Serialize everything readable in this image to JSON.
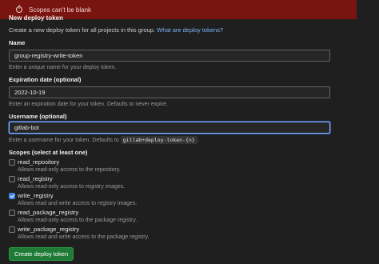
{
  "alert": {
    "message": "Scopes can't be blank",
    "icon": "error-circle-icon",
    "background": "#7a1410"
  },
  "form": {
    "title": "New deploy token",
    "description": "Create a new deploy token for all projects in this group.",
    "help_link": "What are deploy tokens?",
    "name": {
      "label": "Name",
      "value": "group-registry-write-token",
      "hint": "Enter a unique name for your deploy token."
    },
    "expiration": {
      "label": "Expiration date (optional)",
      "value": "2022-10-19",
      "hint": "Enter an expiration date for your token. Defaults to never expire."
    },
    "username": {
      "label": "Username (optional)",
      "value": "gitlab-bot",
      "hint_prefix": "Enter a username for your token. Defaults to",
      "hint_code": "gitlab+deploy-token-{n}",
      "hint_suffix": "."
    },
    "scopes_label": "Scopes (select at least one)",
    "scopes": [
      {
        "name": "read_repository",
        "description": "Allows read-only access to the repository.",
        "checked": false
      },
      {
        "name": "read_registry",
        "description": "Allows read-only access to registry images.",
        "checked": false
      },
      {
        "name": "write_registry",
        "description": "Allows read and write access to registry images.",
        "checked": true
      },
      {
        "name": "read_package_registry",
        "description": "Allows read-only access to the package registry.",
        "checked": false
      },
      {
        "name": "write_package_registry",
        "description": "Allows read and write access to the package registry.",
        "checked": false
      }
    ],
    "submit_label": "Create deploy token"
  },
  "colors": {
    "accent": "#3f87e8",
    "button": "#1f7a35",
    "link": "#7eb3f5"
  }
}
